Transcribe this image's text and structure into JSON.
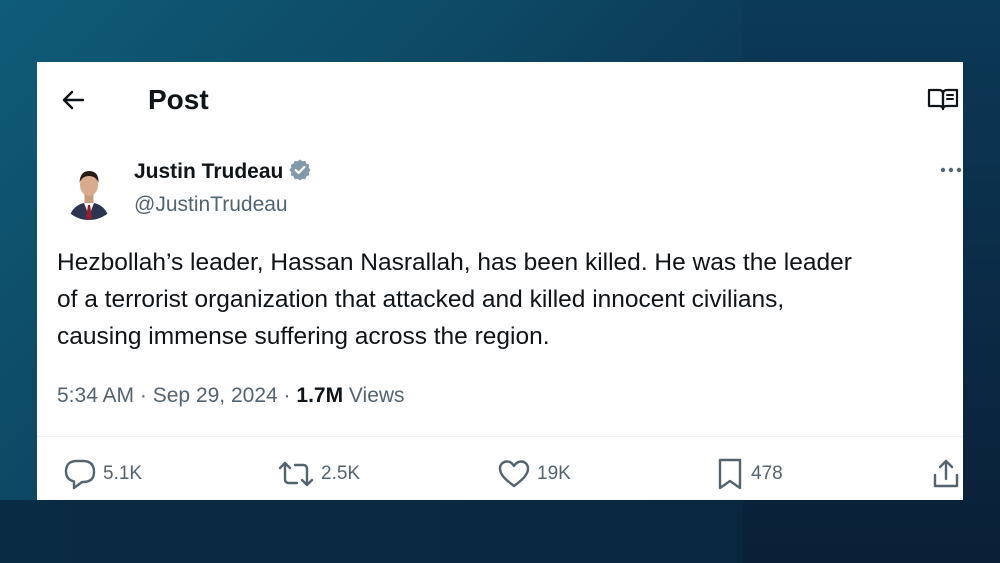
{
  "header": {
    "title": "Post",
    "back_icon": "arrow-left-icon",
    "reader_icon": "book-open-icon"
  },
  "author": {
    "name": "Justin Trudeau",
    "handle": "@JustinTrudeau",
    "verified": true,
    "verified_color": "#829aab"
  },
  "tweet": {
    "lines": [
      "Hezbollah’s leader, Hassan Nasrallah, has been killed. He was the leader",
      "of a terrorist organization that attacked and killed innocent civilians,",
      "causing immense suffering across the region."
    ]
  },
  "meta": {
    "time": "5:34 AM",
    "sep1": "·",
    "date": "Sep 29, 2024",
    "sep2": "·",
    "views_count": "1.7M",
    "views_label": "Views"
  },
  "actions": {
    "reply": {
      "count": "5.1K",
      "icon": "reply-bubble-icon"
    },
    "repost": {
      "count": "2.5K",
      "icon": "repost-icon"
    },
    "like": {
      "count": "19K",
      "icon": "heart-icon"
    },
    "bookmark": {
      "count": "478",
      "icon": "bookmark-icon"
    },
    "share": {
      "icon": "share-icon"
    }
  },
  "colors": {
    "text_primary": "#0f1419",
    "text_secondary": "#536471",
    "background": "#0c3350"
  }
}
